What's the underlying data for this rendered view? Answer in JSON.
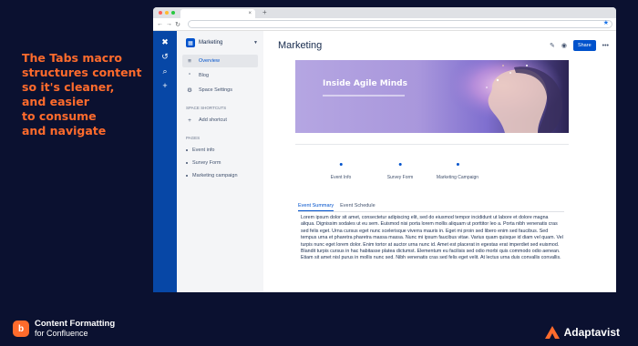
{
  "headline": [
    "The Tabs macro",
    "structures content",
    "so it's cleaner,",
    "and easier",
    "to consume",
    "and navigate"
  ],
  "product": {
    "line1": "Content Formatting",
    "line2": "for Confluence",
    "logo_letter": "b"
  },
  "company": {
    "name": "Adaptavist"
  },
  "colors": {
    "accent": "#ff6b2c",
    "brand_blue": "#0052cc",
    "background": "#0b1130"
  },
  "browser": {
    "tab_close": "×",
    "new_tab": "+",
    "back": "←",
    "forward": "→",
    "reload": "↻",
    "bookmark": "★"
  },
  "rail": [
    {
      "icon": "confluence-logo-icon",
      "glyph": "✖"
    },
    {
      "icon": "recent-icon",
      "glyph": "↺"
    },
    {
      "icon": "search-icon",
      "glyph": "⌕"
    },
    {
      "icon": "create-icon",
      "glyph": "+"
    }
  ],
  "sidebar": {
    "space_name": "Marketing",
    "items": [
      {
        "label": "Overview",
        "icon": "overview-icon",
        "glyph": "≡"
      },
      {
        "label": "Blog",
        "icon": "quote-icon",
        "glyph": "”"
      },
      {
        "label": "Space Settings",
        "icon": "gear-icon",
        "glyph": "⚙"
      }
    ],
    "shortcuts_header": "SPACE SHORTCUTS",
    "add_shortcut": "Add shortcut",
    "pages_header": "PAGES",
    "pages": [
      "Event info",
      "Survey Form",
      "Marketing campaign"
    ]
  },
  "main": {
    "title": "Marketing",
    "share_label": "Share",
    "more_glyph": "•••",
    "hero_title": "Inside Agile Minds",
    "steps": [
      "Event Info",
      "Survey Form",
      "Marketing Campaign"
    ],
    "tabs": [
      "Event Summary",
      "Event Schedule"
    ],
    "body": "Lorem ipsum dolor sit amet, consectetur adipiscing elit, sed do eiusmod tempor incididunt ut labore et dolore magna aliqua. Dignissim sodales ut eu sem. Euismod nisi porta lorem mollis aliquam ut porttitor leo a. Porta nibh venenatis cras sed felis eget. Urna cursus eget nunc scelerisque viverra mauris in. Eget mi proin sed libero enim sed faucibus. Sed tempus urna et pharetra pharetra massa massa. Nunc mi ipsum faucibus vitae. Varius quam quisque id diam vel quam. Vel turpis nunc eget lorem dolor. Enim tortor at auctor urna nunc id. Amet est placerat in egestas erat imperdiet sed euismod. Blandit turpis cursus in hac habitasse platea dictumst. Elementum eu facilisis sed odio morbi quis commodo odio aenean. Etiam sit amet nisl purus in mollis nunc sed. Nibh venenatis cras sed felis eget velit. At lectus urna duis convallis convallis."
  }
}
